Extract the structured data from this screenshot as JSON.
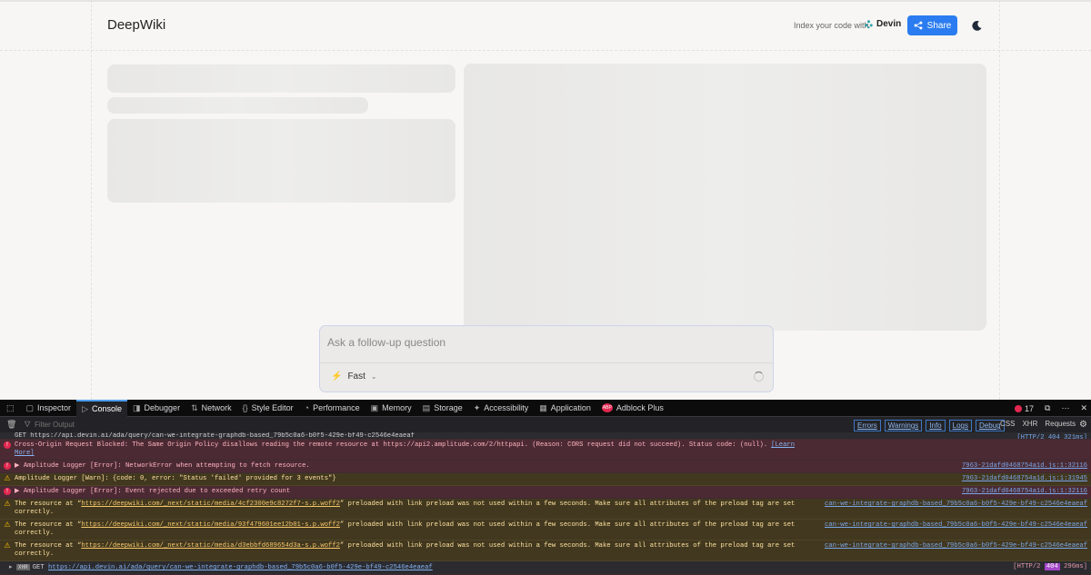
{
  "header": {
    "brand": "DeepWiki",
    "index_text": "Index your code with",
    "devin_label": "Devin",
    "share_label": "Share"
  },
  "ask": {
    "placeholder": "Ask a follow-up question",
    "mode_label": "Fast"
  },
  "devtools": {
    "tabs": [
      {
        "label": "Inspector",
        "icon": "inspector-icon"
      },
      {
        "label": "Console",
        "icon": "console-icon"
      },
      {
        "label": "Debugger",
        "icon": "debugger-icon"
      },
      {
        "label": "Network",
        "icon": "network-icon"
      },
      {
        "label": "Style Editor",
        "icon": "style-editor-icon"
      },
      {
        "label": "Performance",
        "icon": "performance-icon"
      },
      {
        "label": "Memory",
        "icon": "memory-icon"
      },
      {
        "label": "Storage",
        "icon": "storage-icon"
      },
      {
        "label": "Accessibility",
        "icon": "accessibility-icon"
      },
      {
        "label": "Application",
        "icon": "application-icon"
      },
      {
        "label": "Adblock Plus",
        "icon": "adblock-icon"
      }
    ],
    "active_tab": "Console",
    "error_count": "17",
    "filter_placeholder": "Filter Output",
    "levels": [
      "Errors",
      "Warnings",
      "Info",
      "Logs",
      "Debug"
    ],
    "extras": [
      "CSS",
      "XHR",
      "Requests"
    ],
    "logs": [
      {
        "kind": "plain",
        "text": "GET https://api.devin.ai/ada/query/can-we-integrate-graphdb-based_79b5c0a6-b0f5-429e-bf49-c2546e4eaeaf",
        "src": "[HTTP/2 404 321ms]"
      },
      {
        "kind": "err",
        "text": "Cross-Origin Request Blocked: The Same Origin Policy disallows reading the remote resource at https://api2.amplitude.com/2/httpapi. (Reason: CORS request did not succeed). Status code: (null).",
        "link": "[Learn More]",
        "src": ""
      },
      {
        "kind": "err",
        "text": "▶ Amplitude Logger [Error]: NetworkError when attempting to fetch resource.",
        "src": "7963-21dafd0468754a1d.js:1:32116"
      },
      {
        "kind": "warn",
        "text": "Amplitude Logger [Warn]: {code: 0, error: \"Status 'failed' provided for 3 events\"}",
        "src": "7963-21dafd0468754a1d.js:1:31945"
      },
      {
        "kind": "err",
        "text": "▶ Amplitude Logger [Error]: Event rejected due to exceeded retry count",
        "src": "7963-21dafd0468754a1d.js:1:32116"
      },
      {
        "kind": "warn",
        "text_pre": "The resource at “",
        "url": "https://deepwiki.com/_next/static/media/4cf2300e9c8272f7-s.p.woff2",
        "text_post": "” preloaded with link preload was not used within a few seconds. Make sure all attributes of the preload tag are set correctly.",
        "src": "can-we-integrate-graphdb-based_79b5c0a6-b0f5-429e-bf49-c2546e4eaeaf"
      },
      {
        "kind": "warn",
        "text_pre": "The resource at “",
        "url": "https://deepwiki.com/_next/static/media/93f479601ee12b01-s.p.woff2",
        "text_post": "” preloaded with link preload was not used within a few seconds. Make sure all attributes of the preload tag are set correctly.",
        "src": "can-we-integrate-graphdb-based_79b5c0a6-b0f5-429e-bf49-c2546e4eaeaf"
      },
      {
        "kind": "warn",
        "text_pre": "The resource at “",
        "url": "https://deepwiki.com/_next/static/media/d3ebbfd689654d3a-s.p.woff2",
        "text_post": "” preloaded with link preload was not used within a few seconds. Make sure all attributes of the preload tag are set correctly.",
        "src": "can-we-integrate-graphdb-based_79b5c0a6-b0f5-429e-bf49-c2546e4eaeaf"
      }
    ],
    "last_log": {
      "method": "GET",
      "url": "https://api.devin.ai/ada/query/can-we-integrate-graphdb-based_79b5c0a6-b0f5-429e-bf49-c2546e4eaeaf",
      "protocol": "[HTTP/2",
      "status": "404",
      "time": "296ms]"
    }
  }
}
